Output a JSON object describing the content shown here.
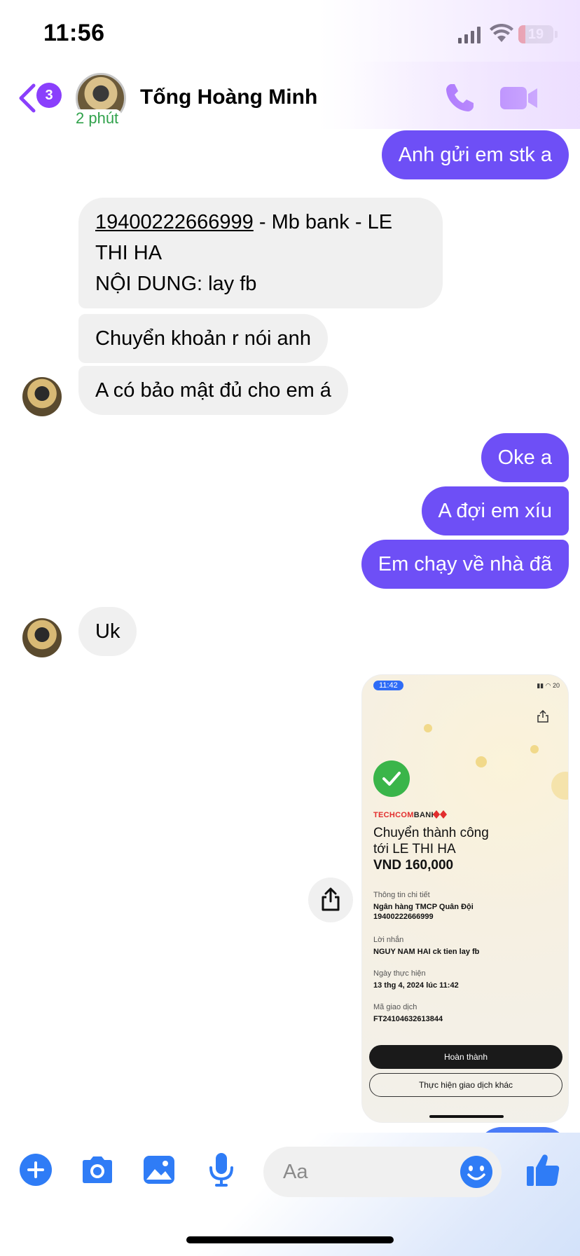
{
  "status_bar": {
    "time": "11:56",
    "battery": "19",
    "battery_level": 0.19
  },
  "header": {
    "back_badge": "3",
    "active_status": "2 phút",
    "contact_name": "Tống Hoàng Minh",
    "icons": [
      "back-chevron-icon",
      "phone-icon",
      "video-camera-icon"
    ],
    "accent_color": "#8a3ffc"
  },
  "messages": [
    {
      "from": "me",
      "text": "Anh gửi em stk a"
    },
    {
      "from": "contact",
      "account": "19400222666999",
      "rest": " - Mb bank - LE THI HA",
      "line2": "NỘI DUNG: lay fb"
    },
    {
      "from": "contact",
      "text": "Chuyển khoản r nói anh"
    },
    {
      "from": "contact",
      "text": "A có bảo mật đủ cho em á"
    },
    {
      "from": "me",
      "text": "Oke a"
    },
    {
      "from": "me",
      "text": "A đợi em xíu"
    },
    {
      "from": "me",
      "text": "Em chạy về nhà đã"
    },
    {
      "from": "contact",
      "text": "Uk"
    }
  ],
  "shared_image": {
    "time": "11:42",
    "status": "20",
    "bank_name_red": "TECHCOM",
    "bank_name_dark": "BANK",
    "title_line1": "Chuyển thành công",
    "title_line2": "tới LE THI HA",
    "amount": "VND 160,000",
    "detail_label": "Thông tin chi tiết",
    "detail_bank": "Ngân hàng TMCP Quân Đội",
    "detail_account": "19400222666999",
    "message_label": "Lời nhắn",
    "message_value": "NGUY NAM HAI ck tien lay fb",
    "date_label": "Ngày thực hiện",
    "date_value": "13 thg 4, 2024 lúc 11:42",
    "txn_label": "Mã giao dịch",
    "txn_value": "FT24104632613844",
    "done_button": "Hoàn thành",
    "other_button": "Thực hiện giao dịch khác"
  },
  "composer": {
    "placeholder": "Aa",
    "icons": [
      "plus-icon",
      "camera-icon",
      "gallery-icon",
      "microphone-icon",
      "emoji-icon",
      "thumbs-up-icon"
    ],
    "accent_color": "#2f7cf6"
  },
  "colors": {
    "outgoing_bubble": "#6e4ff6",
    "incoming_bubble": "#f0f0f0"
  }
}
